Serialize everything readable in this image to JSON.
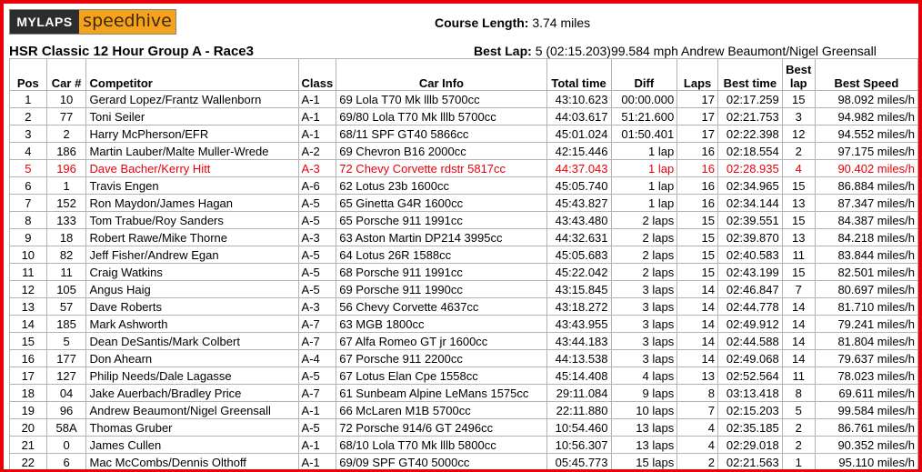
{
  "logo": {
    "left": "MYLAPS",
    "right": "speedhive"
  },
  "course": {
    "label": "Course Length:",
    "value": "3.74 miles"
  },
  "bestlap": {
    "label": "Best Lap:",
    "value": "5 (02:15.203)99.584 mph Andrew Beaumont/Nigel Greensall"
  },
  "title": "HSR Classic 12 Hour Group A - Race3",
  "headers": {
    "pos": "Pos",
    "car": "Car #",
    "competitor": "Competitor",
    "class": "Class",
    "carinfo": "Car Info",
    "total": "Total time",
    "diff": "Diff",
    "laps": "Laps",
    "besttime": "Best time",
    "bestlap1": "Best",
    "bestlap2": "lap",
    "bestspeed": "Best Speed"
  },
  "rows": [
    [
      "1",
      "10",
      "Gerard Lopez/Frantz Wallenborn",
      "A-1",
      "69 Lola T70 Mk lllb 5700cc",
      "43:10.623",
      "00:00.000",
      "17",
      "02:17.259",
      "15",
      "98.092 miles/h"
    ],
    [
      "2",
      "77",
      "Toni Seiler",
      "A-1",
      "69/80 Lola T70 Mk lllb 5700cc",
      "44:03.617",
      "51:21.600",
      "17",
      "02:21.753",
      "3",
      "94.982 miles/h"
    ],
    [
      "3",
      "2",
      "Harry McPherson/EFR",
      "A-1",
      "68/11 SPF GT40 5866cc",
      "45:01.024",
      "01:50.401",
      "17",
      "02:22.398",
      "12",
      "94.552 miles/h"
    ],
    [
      "4",
      "186",
      "Martin Lauber/Malte Muller-Wrede",
      "A-2",
      "69 Chevron B16 2000cc",
      "42:15.446",
      "1 lap",
      "16",
      "02:18.554",
      "2",
      "97.175 miles/h"
    ],
    [
      "5",
      "196",
      "Dave Bacher/Kerry Hitt",
      "A-3",
      "72 Chevy Corvette rdstr 5817cc",
      "44:37.043",
      "1 lap",
      "16",
      "02:28.935",
      "4",
      "90.402 miles/h"
    ],
    [
      "6",
      "1",
      "Travis Engen",
      "A-6",
      "62 Lotus 23b 1600cc",
      "45:05.740",
      "1 lap",
      "16",
      "02:34.965",
      "15",
      "86.884 miles/h"
    ],
    [
      "7",
      "152",
      "Ron Maydon/James Hagan",
      "A-5",
      "65 Ginetta G4R 1600cc",
      "45:43.827",
      "1 lap",
      "16",
      "02:34.144",
      "13",
      "87.347 miles/h"
    ],
    [
      "8",
      "133",
      "Tom Trabue/Roy Sanders",
      "A-5",
      "65 Porsche 911 1991cc",
      "43:43.480",
      "2 laps",
      "15",
      "02:39.551",
      "15",
      "84.387 miles/h"
    ],
    [
      "9",
      "18",
      "Robert Rawe/Mike Thorne",
      "A-3",
      "63 Aston Martin DP214 3995cc",
      "44:32.631",
      "2 laps",
      "15",
      "02:39.870",
      "13",
      "84.218 miles/h"
    ],
    [
      "10",
      "82",
      "Jeff Fisher/Andrew Egan",
      "A-5",
      "64 Lotus 26R 1588cc",
      "45:05.683",
      "2 laps",
      "15",
      "02:40.583",
      "11",
      "83.844 miles/h"
    ],
    [
      "11",
      "11",
      "Craig Watkins",
      "A-5",
      "68 Porsche 911 1991cc",
      "45:22.042",
      "2 laps",
      "15",
      "02:43.199",
      "15",
      "82.501 miles/h"
    ],
    [
      "12",
      "105",
      "Angus Haig",
      "A-5",
      "69 Porsche 911 1990cc",
      "43:15.845",
      "3 laps",
      "14",
      "02:46.847",
      "7",
      "80.697 miles/h"
    ],
    [
      "13",
      "57",
      "Dave Roberts",
      "A-3",
      "56 Chevy Corvette 4637cc",
      "43:18.272",
      "3 laps",
      "14",
      "02:44.778",
      "14",
      "81.710 miles/h"
    ],
    [
      "14",
      "185",
      "Mark Ashworth",
      "A-7",
      "63 MGB 1800cc",
      "43:43.955",
      "3 laps",
      "14",
      "02:49.912",
      "14",
      "79.241 miles/h"
    ],
    [
      "15",
      "5",
      "Dean DeSantis/Mark Colbert",
      "A-7",
      "67 Alfa Romeo GT jr 1600cc",
      "43:44.183",
      "3 laps",
      "14",
      "02:44.588",
      "14",
      "81.804 miles/h"
    ],
    [
      "16",
      "177",
      "Don Ahearn",
      "A-4",
      "67 Porsche 911 2200cc",
      "44:13.538",
      "3 laps",
      "14",
      "02:49.068",
      "14",
      "79.637 miles/h"
    ],
    [
      "17",
      "127",
      "Philip Needs/Dale Lagasse",
      "A-5",
      "67 Lotus Elan Cpe 1558cc",
      "45:14.408",
      "4 laps",
      "13",
      "02:52.564",
      "11",
      "78.023 miles/h"
    ],
    [
      "18",
      "04",
      "Jake Auerbach/Bradley Price",
      "A-7",
      "61 Sunbeam Alpine LeMans 1575cc",
      "29:11.084",
      "9 laps",
      "8",
      "03:13.418",
      "8",
      "69.611 miles/h"
    ],
    [
      "19",
      "96",
      "Andrew Beaumont/Nigel Greensall",
      "A-1",
      "66 McLaren M1B 5700cc",
      "22:11.880",
      "10 laps",
      "7",
      "02:15.203",
      "5",
      "99.584 miles/h"
    ],
    [
      "20",
      "58A",
      "Thomas Gruber",
      "A-5",
      "72 Porsche 914/6 GT 2496cc",
      "10:54.460",
      "13 laps",
      "4",
      "02:35.185",
      "2",
      "86.761 miles/h"
    ],
    [
      "21",
      "0",
      "James Cullen",
      "A-1",
      "68/10 Lola T70 Mk lllb 5800cc",
      "10:56.307",
      "13 laps",
      "4",
      "02:29.018",
      "2",
      "90.352 miles/h"
    ],
    [
      "22",
      "6",
      "Mac McCombs/Dennis Olthoff",
      "A-1",
      "69/09 SPF GT40 5000cc",
      "05:45.773",
      "15 laps",
      "2",
      "02:21.563",
      "1",
      "95.110 miles/h"
    ]
  ],
  "highlight_row_index": 4,
  "colors": {
    "border": "#e8000b",
    "highlight_text": "#e8000b",
    "logo_dark": "#2d2d2d",
    "logo_orange": "#f7a21b"
  }
}
